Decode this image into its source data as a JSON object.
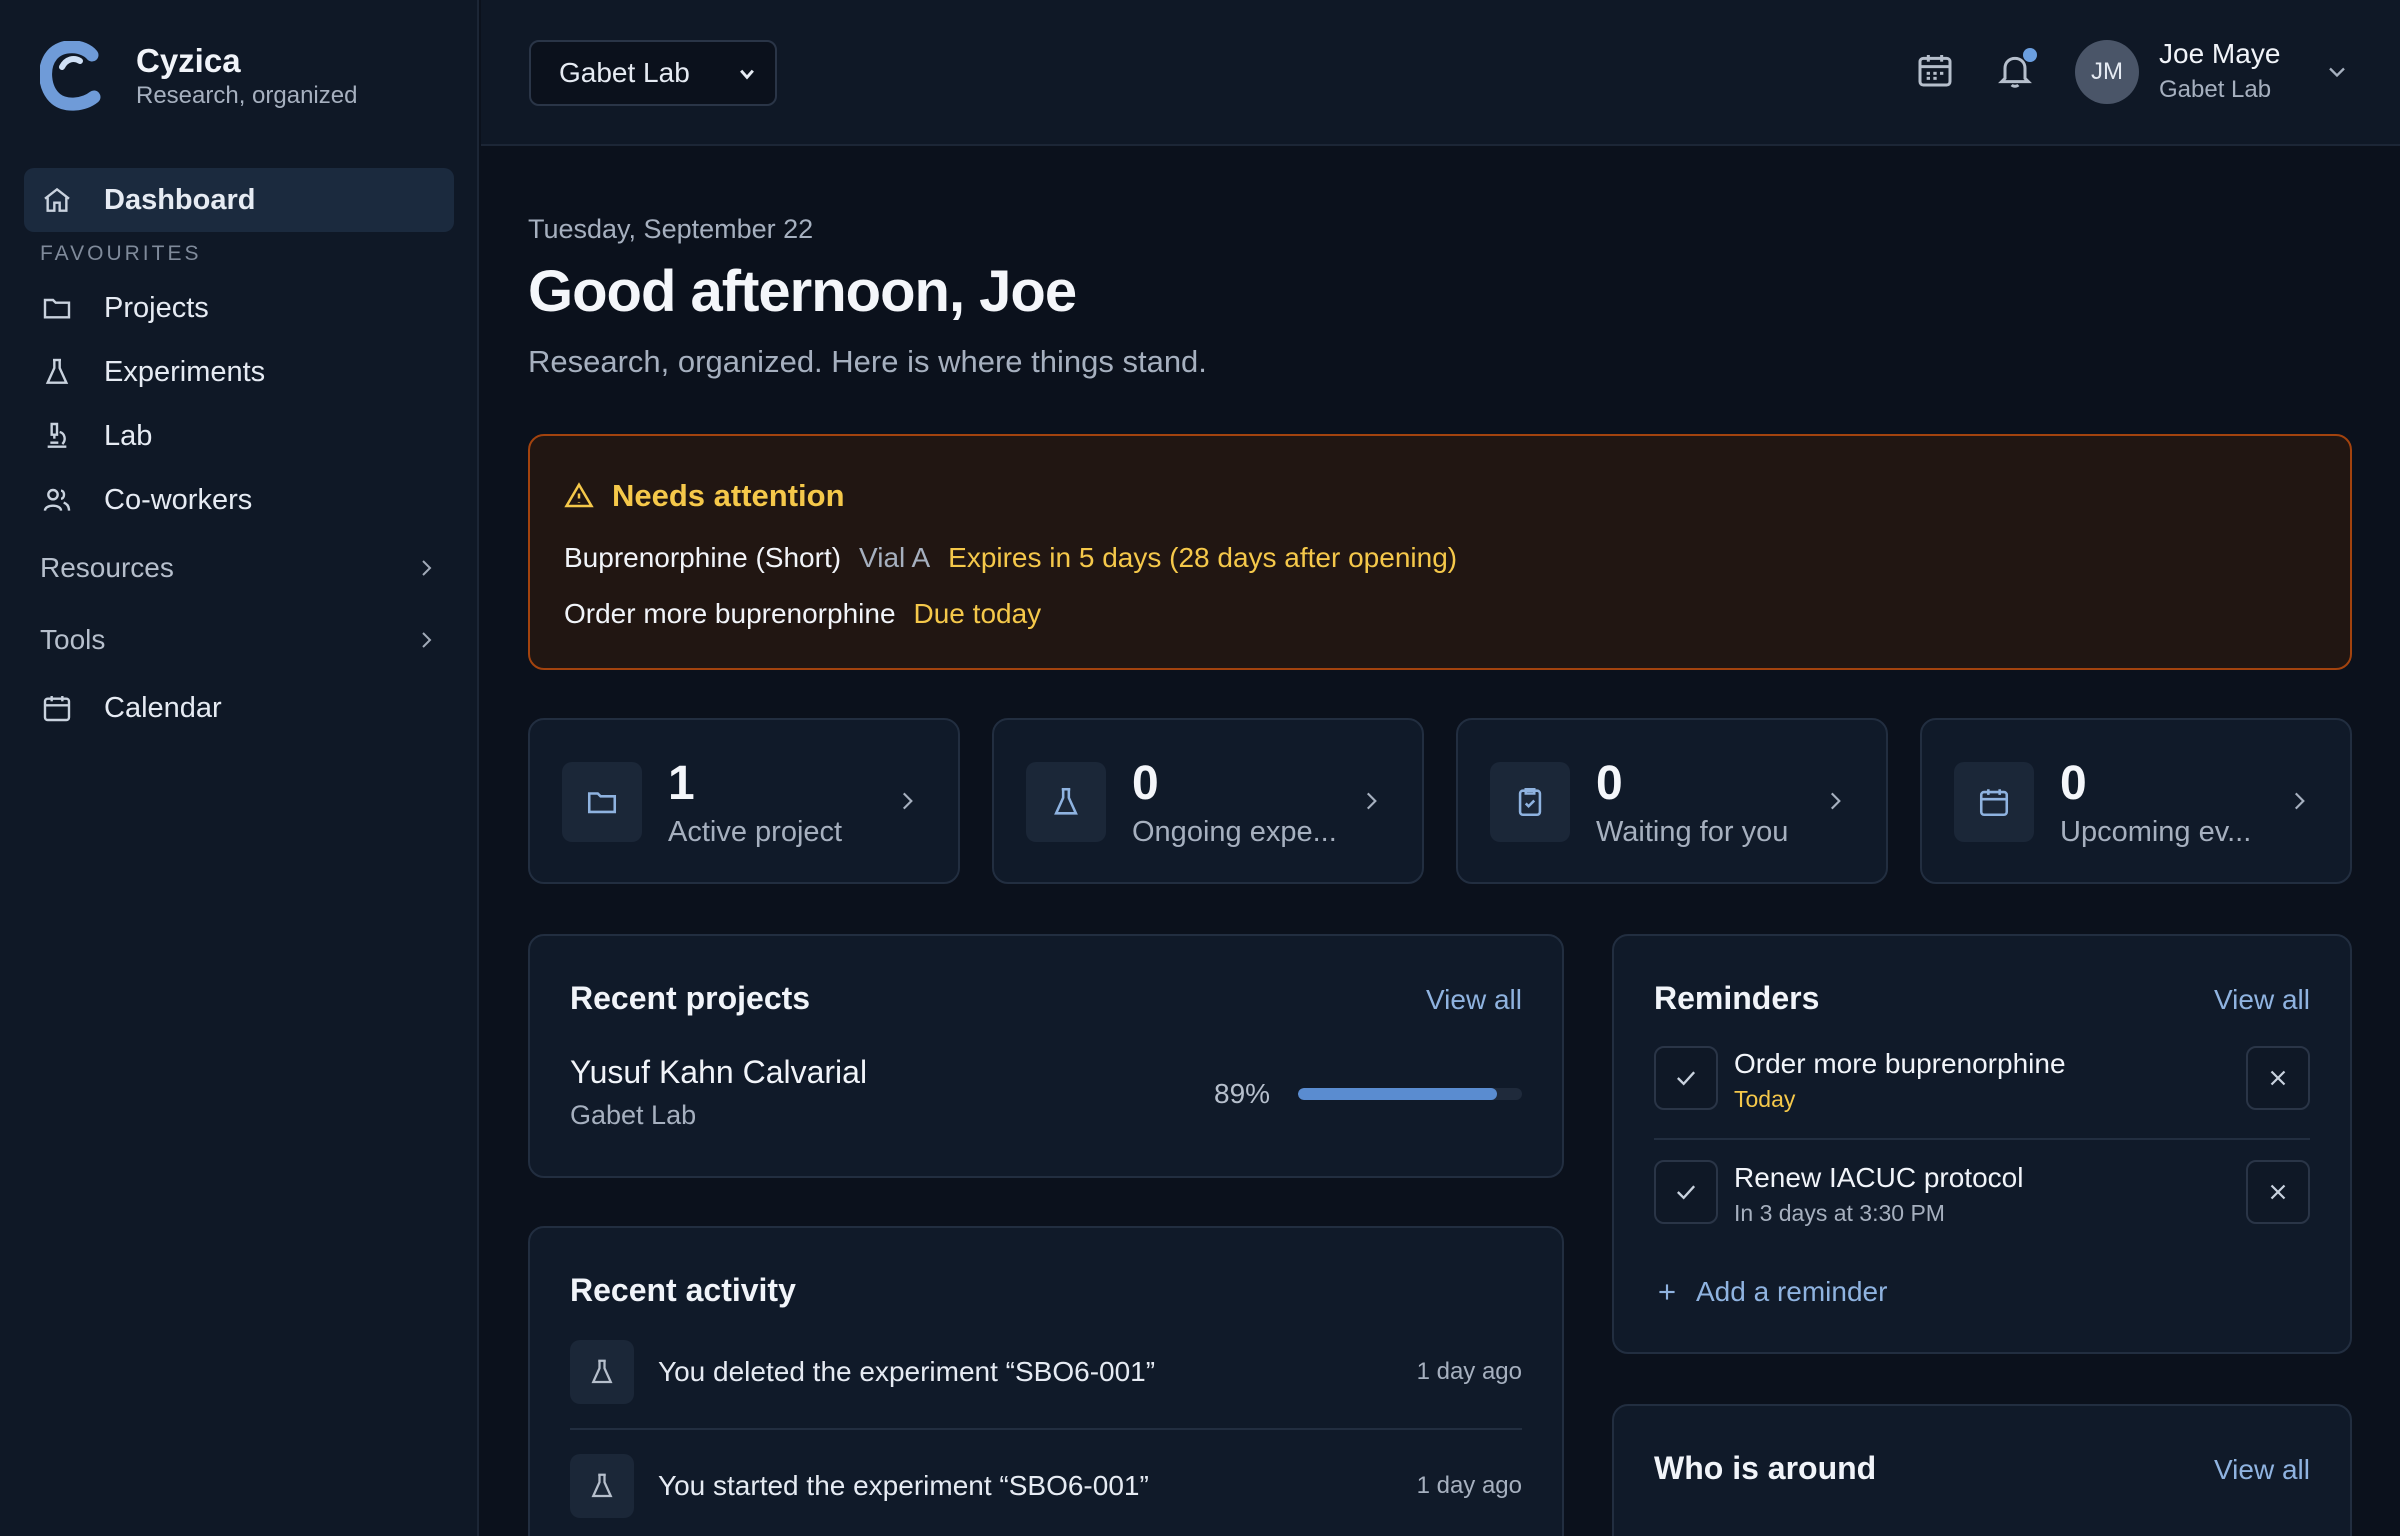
{
  "brand": {
    "name": "Cyzica",
    "tagline": "Research, organized"
  },
  "sidebar": {
    "dashboard": "Dashboard",
    "section_label": "FAVOURITES",
    "items": [
      "Projects",
      "Experiments",
      "Lab",
      "Co-workers"
    ],
    "groups": [
      "Resources",
      "Tools"
    ],
    "calendar": "Calendar"
  },
  "topbar": {
    "lab_selector": "Gabet Lab",
    "user": {
      "initials": "JM",
      "name": "Joe Maye",
      "lab": "Gabet Lab"
    }
  },
  "header": {
    "date": "Tuesday, September 22",
    "greeting": "Good afternoon, Joe",
    "subtitle": "Research, organized. Here is where things stand."
  },
  "attention": {
    "title": "Needs attention",
    "rows": [
      {
        "name": "Buprenorphine (Short)",
        "detail": "Vial A",
        "status": "Expires in 5 days (28 days after opening)"
      },
      {
        "name": "Order more buprenorphine",
        "status": "Due today"
      }
    ]
  },
  "stats": [
    {
      "value": "1",
      "label": "Active project"
    },
    {
      "value": "0",
      "label": "Ongoing expe..."
    },
    {
      "value": "0",
      "label": "Waiting for you"
    },
    {
      "value": "0",
      "label": "Upcoming ev..."
    }
  ],
  "recent_projects": {
    "title": "Recent projects",
    "view_all": "View all",
    "items": [
      {
        "name": "Yusuf Kahn Calvarial",
        "lab": "Gabet Lab",
        "progress_label": "89%",
        "progress": 0.89
      }
    ]
  },
  "recent_activity": {
    "title": "Recent activity",
    "items": [
      {
        "text": "You deleted the experiment “SBO6-001”",
        "time": "1 day ago"
      },
      {
        "text": "You started the experiment “SBO6-001”",
        "time": "1 day ago"
      }
    ]
  },
  "reminders": {
    "title": "Reminders",
    "view_all": "View all",
    "items": [
      {
        "title": "Order more buprenorphine",
        "when": "Today"
      },
      {
        "title": "Renew IACUC protocol",
        "when": "In 3 days at 3:30 PM"
      }
    ],
    "add_label": "Add a reminder"
  },
  "who_is_around": {
    "title": "Who is around",
    "view_all": "View all"
  },
  "colors": {
    "accent": "#8fb3e0",
    "warning": "#f5c84a",
    "warning_border": "#a3430e",
    "progress": "#5a8cd0"
  }
}
